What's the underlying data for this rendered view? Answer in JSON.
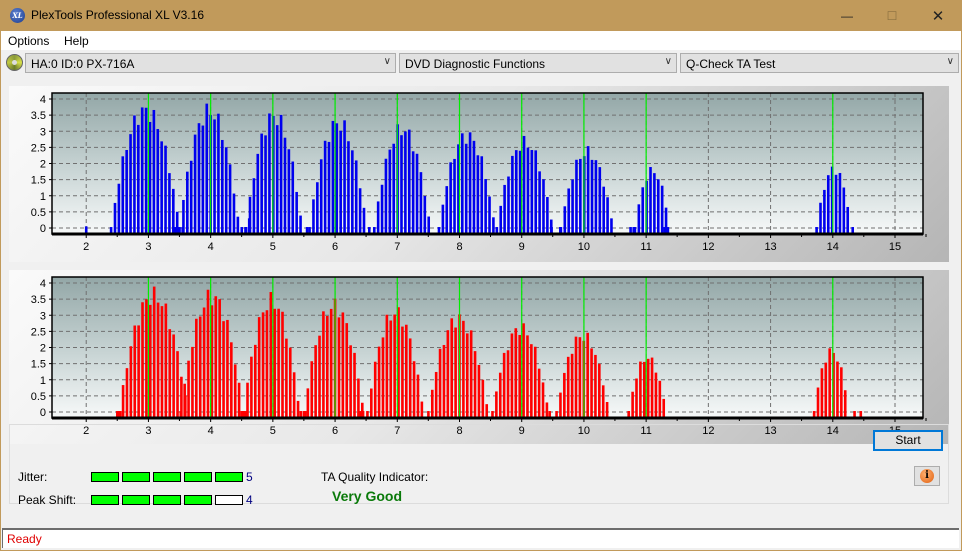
{
  "window": {
    "title": "PlexTools Professional XL V3.16",
    "logo_text": "XL",
    "minimize_glyph": "—",
    "maximize_glyph": "☐",
    "close_glyph": "✕"
  },
  "menu": {
    "items": [
      {
        "label": "Options"
      },
      {
        "label": "Help"
      }
    ]
  },
  "toolbar": {
    "drive": {
      "value": "HA:0 ID:0  PX-716A",
      "icon": "disc-drive-icon"
    },
    "function": {
      "value": "DVD Diagnostic Functions"
    },
    "test": {
      "value": "Q-Check TA Test"
    },
    "arrow_glyph": "∨"
  },
  "results": {
    "jitter_label": "Jitter:",
    "jitter_value": "5",
    "jitter_level": 5,
    "peak_shift_label": "Peak Shift:",
    "peak_shift_value": "4",
    "peak_shift_level": 4,
    "meter_max": 5,
    "ta_label": "TA Quality Indicator:",
    "ta_value": "Very Good",
    "ta_color": "#0a7a0a"
  },
  "buttons": {
    "start": "Start",
    "info_glyph": "i"
  },
  "status": {
    "text": "Ready",
    "color": "#e00000"
  },
  "colors": {
    "series_top": "#0000ee",
    "series_bottom": "#ff0000",
    "marker": "#00ee00"
  },
  "chart_data": [
    {
      "type": "bar",
      "name": "TA histogram (inner/top)",
      "xlim": [
        1.45,
        15.45
      ],
      "ylim": [
        0,
        4
      ],
      "xticks": [
        2,
        3,
        4,
        5,
        6,
        7,
        8,
        9,
        10,
        11,
        12,
        13,
        14,
        15
      ],
      "yticks": [
        "0",
        "0.5",
        "1",
        "1.5",
        "2",
        "2.5",
        "3",
        "3.5",
        "4"
      ],
      "marker_lines": [
        3,
        4,
        5,
        6,
        7,
        8,
        9,
        10,
        11,
        14
      ],
      "grid": true,
      "peaks": [
        {
          "center": 2.95,
          "height": 3.78,
          "width": 0.55
        },
        {
          "center": 3.98,
          "height": 3.76,
          "width": 0.48
        },
        {
          "center": 5.02,
          "height": 3.6,
          "width": 0.45
        },
        {
          "center": 6.05,
          "height": 3.38,
          "width": 0.46
        },
        {
          "center": 7.08,
          "height": 3.18,
          "width": 0.45
        },
        {
          "center": 8.12,
          "height": 2.97,
          "width": 0.45
        },
        {
          "center": 9.05,
          "height": 2.75,
          "width": 0.45
        },
        {
          "center": 10.05,
          "height": 2.45,
          "width": 0.42
        },
        {
          "center": 11.1,
          "height": 1.85,
          "width": 0.28
        },
        {
          "center": 14.02,
          "height": 1.9,
          "width": 0.28
        }
      ],
      "sparse_bars": [
        {
          "x": 2.0,
          "y": 0.05
        },
        {
          "x": 3.43,
          "y": 0.03
        },
        {
          "x": 3.55,
          "y": 0.03
        },
        {
          "x": 4.5,
          "y": 0.03
        },
        {
          "x": 4.56,
          "y": 0.03
        },
        {
          "x": 4.62,
          "y": 0.3
        },
        {
          "x": 5.55,
          "y": 0.03
        },
        {
          "x": 6.55,
          "y": 0.03
        },
        {
          "x": 9.48,
          "y": 0.03
        },
        {
          "x": 9.62,
          "y": 0.03
        },
        {
          "x": 10.75,
          "y": 0.03
        },
        {
          "x": 10.8,
          "y": 0.03
        },
        {
          "x": 11.3,
          "y": 0.03
        },
        {
          "x": 11.35,
          "y": 0.03
        },
        {
          "x": 14.32,
          "y": 0.03
        }
      ]
    },
    {
      "type": "bar",
      "name": "TA histogram (outer/bottom)",
      "xlim": [
        1.45,
        15.45
      ],
      "ylim": [
        0,
        4
      ],
      "xticks": [
        2,
        3,
        4,
        5,
        6,
        7,
        8,
        9,
        10,
        11,
        12,
        13,
        14,
        15
      ],
      "yticks": [
        "0",
        "0.5",
        "1",
        "1.5",
        "2",
        "2.5",
        "3",
        "3.5",
        "4"
      ],
      "marker_lines": [
        3,
        4,
        5,
        6,
        7,
        8,
        9,
        10,
        11,
        14
      ],
      "grid": true,
      "peaks": [
        {
          "center": 3.08,
          "height": 3.75,
          "width": 0.55
        },
        {
          "center": 4.02,
          "height": 3.72,
          "width": 0.5
        },
        {
          "center": 4.98,
          "height": 3.58,
          "width": 0.45
        },
        {
          "center": 5.98,
          "height": 3.42,
          "width": 0.48
        },
        {
          "center": 6.97,
          "height": 3.2,
          "width": 0.45
        },
        {
          "center": 7.98,
          "height": 3.0,
          "width": 0.48
        },
        {
          "center": 8.98,
          "height": 2.7,
          "width": 0.45
        },
        {
          "center": 9.98,
          "height": 2.45,
          "width": 0.42
        },
        {
          "center": 11.02,
          "height": 1.75,
          "width": 0.3
        },
        {
          "center": 13.98,
          "height": 1.95,
          "width": 0.28
        }
      ],
      "sparse_bars": [
        {
          "x": 2.5,
          "y": 0.03
        },
        {
          "x": 2.55,
          "y": 0.03
        },
        {
          "x": 4.5,
          "y": 0.03
        },
        {
          "x": 4.56,
          "y": 0.03
        },
        {
          "x": 5.45,
          "y": 0.03
        },
        {
          "x": 5.52,
          "y": 0.03
        },
        {
          "x": 6.4,
          "y": 0.03
        },
        {
          "x": 6.45,
          "y": 0.03
        },
        {
          "x": 9.45,
          "y": 0.03
        },
        {
          "x": 10.72,
          "y": 0.03
        },
        {
          "x": 14.35,
          "y": 0.03
        },
        {
          "x": 14.45,
          "y": 0.03
        }
      ]
    }
  ]
}
